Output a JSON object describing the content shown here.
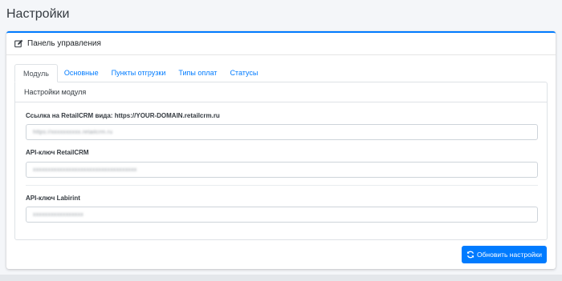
{
  "page": {
    "title": "Настройки"
  },
  "panel": {
    "title": "Панель управления",
    "icon": "edit-icon"
  },
  "tabs": [
    {
      "label": "Модуль",
      "active": true
    },
    {
      "label": "Основные",
      "active": false
    },
    {
      "label": "Пункты отгрузки",
      "active": false
    },
    {
      "label": "Типы оплат",
      "active": false
    },
    {
      "label": "Статусы",
      "active": false
    }
  ],
  "module": {
    "title": "Настройки модуля",
    "fields": [
      {
        "label": "Ссылка на RetailCRM вида: https://YOUR-DOMAIN.retailcrm.ru",
        "value": "https://xxxxxxxxxx.retailcrm.ru"
      },
      {
        "label": "API-ключ RetailCRM",
        "value": "xxxxxxxxxxxxxxxxxxxxxxxxxxxxxxxxxxx"
      },
      {
        "label": "API-ключ Labirint",
        "value": "xxxxxxxxxxxxxxxxx"
      }
    ]
  },
  "actions": {
    "update_label": "Обновить настройки",
    "update_icon": "sync-icon"
  },
  "colors": {
    "accent": "#007bff",
    "background": "#f4f6f9"
  }
}
